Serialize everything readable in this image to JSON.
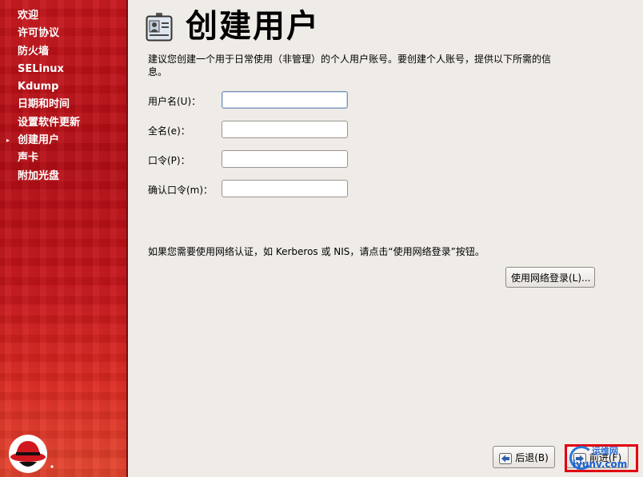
{
  "sidebar": {
    "items": [
      {
        "label": "欢迎"
      },
      {
        "label": "许可协议"
      },
      {
        "label": "防火墙"
      },
      {
        "label": "SELinux"
      },
      {
        "label": "Kdump"
      },
      {
        "label": "日期和时间"
      },
      {
        "label": "设置软件更新"
      },
      {
        "label": "创建用户",
        "current": true
      },
      {
        "label": "声卡"
      },
      {
        "label": "附加光盘"
      }
    ],
    "current_marker": "▸",
    "logo_icon": "redhat-shadowman-icon"
  },
  "page": {
    "title": "创建用户",
    "title_icon": "user-id-card-icon",
    "intro": "建议您创建一个用于日常使用（非管理）的个人用户账号。要创建个人账号，提供以下所需的信息。"
  },
  "form": {
    "username_label": "用户名(U)：",
    "username_value": "",
    "fullname_label": "全名(e)：",
    "fullname_value": "",
    "password_label": "口令(P)：",
    "password_value": "",
    "confirm_label": "确认口令(m)：",
    "confirm_value": ""
  },
  "network": {
    "note": "如果您需要使用网络认证，如 Kerberos 或 NIS，请点击“使用网络登录”按钮。",
    "button_label": "使用网络登录(L)..."
  },
  "nav": {
    "back_label": "后退(B)",
    "forward_label": "前进(F)"
  },
  "watermark": {
    "line1": "运维网",
    "line2": "iyunv.com"
  },
  "colors": {
    "sidebar_red": "#c4151b",
    "background": "#efebe7",
    "highlight_red": "#e00010"
  }
}
